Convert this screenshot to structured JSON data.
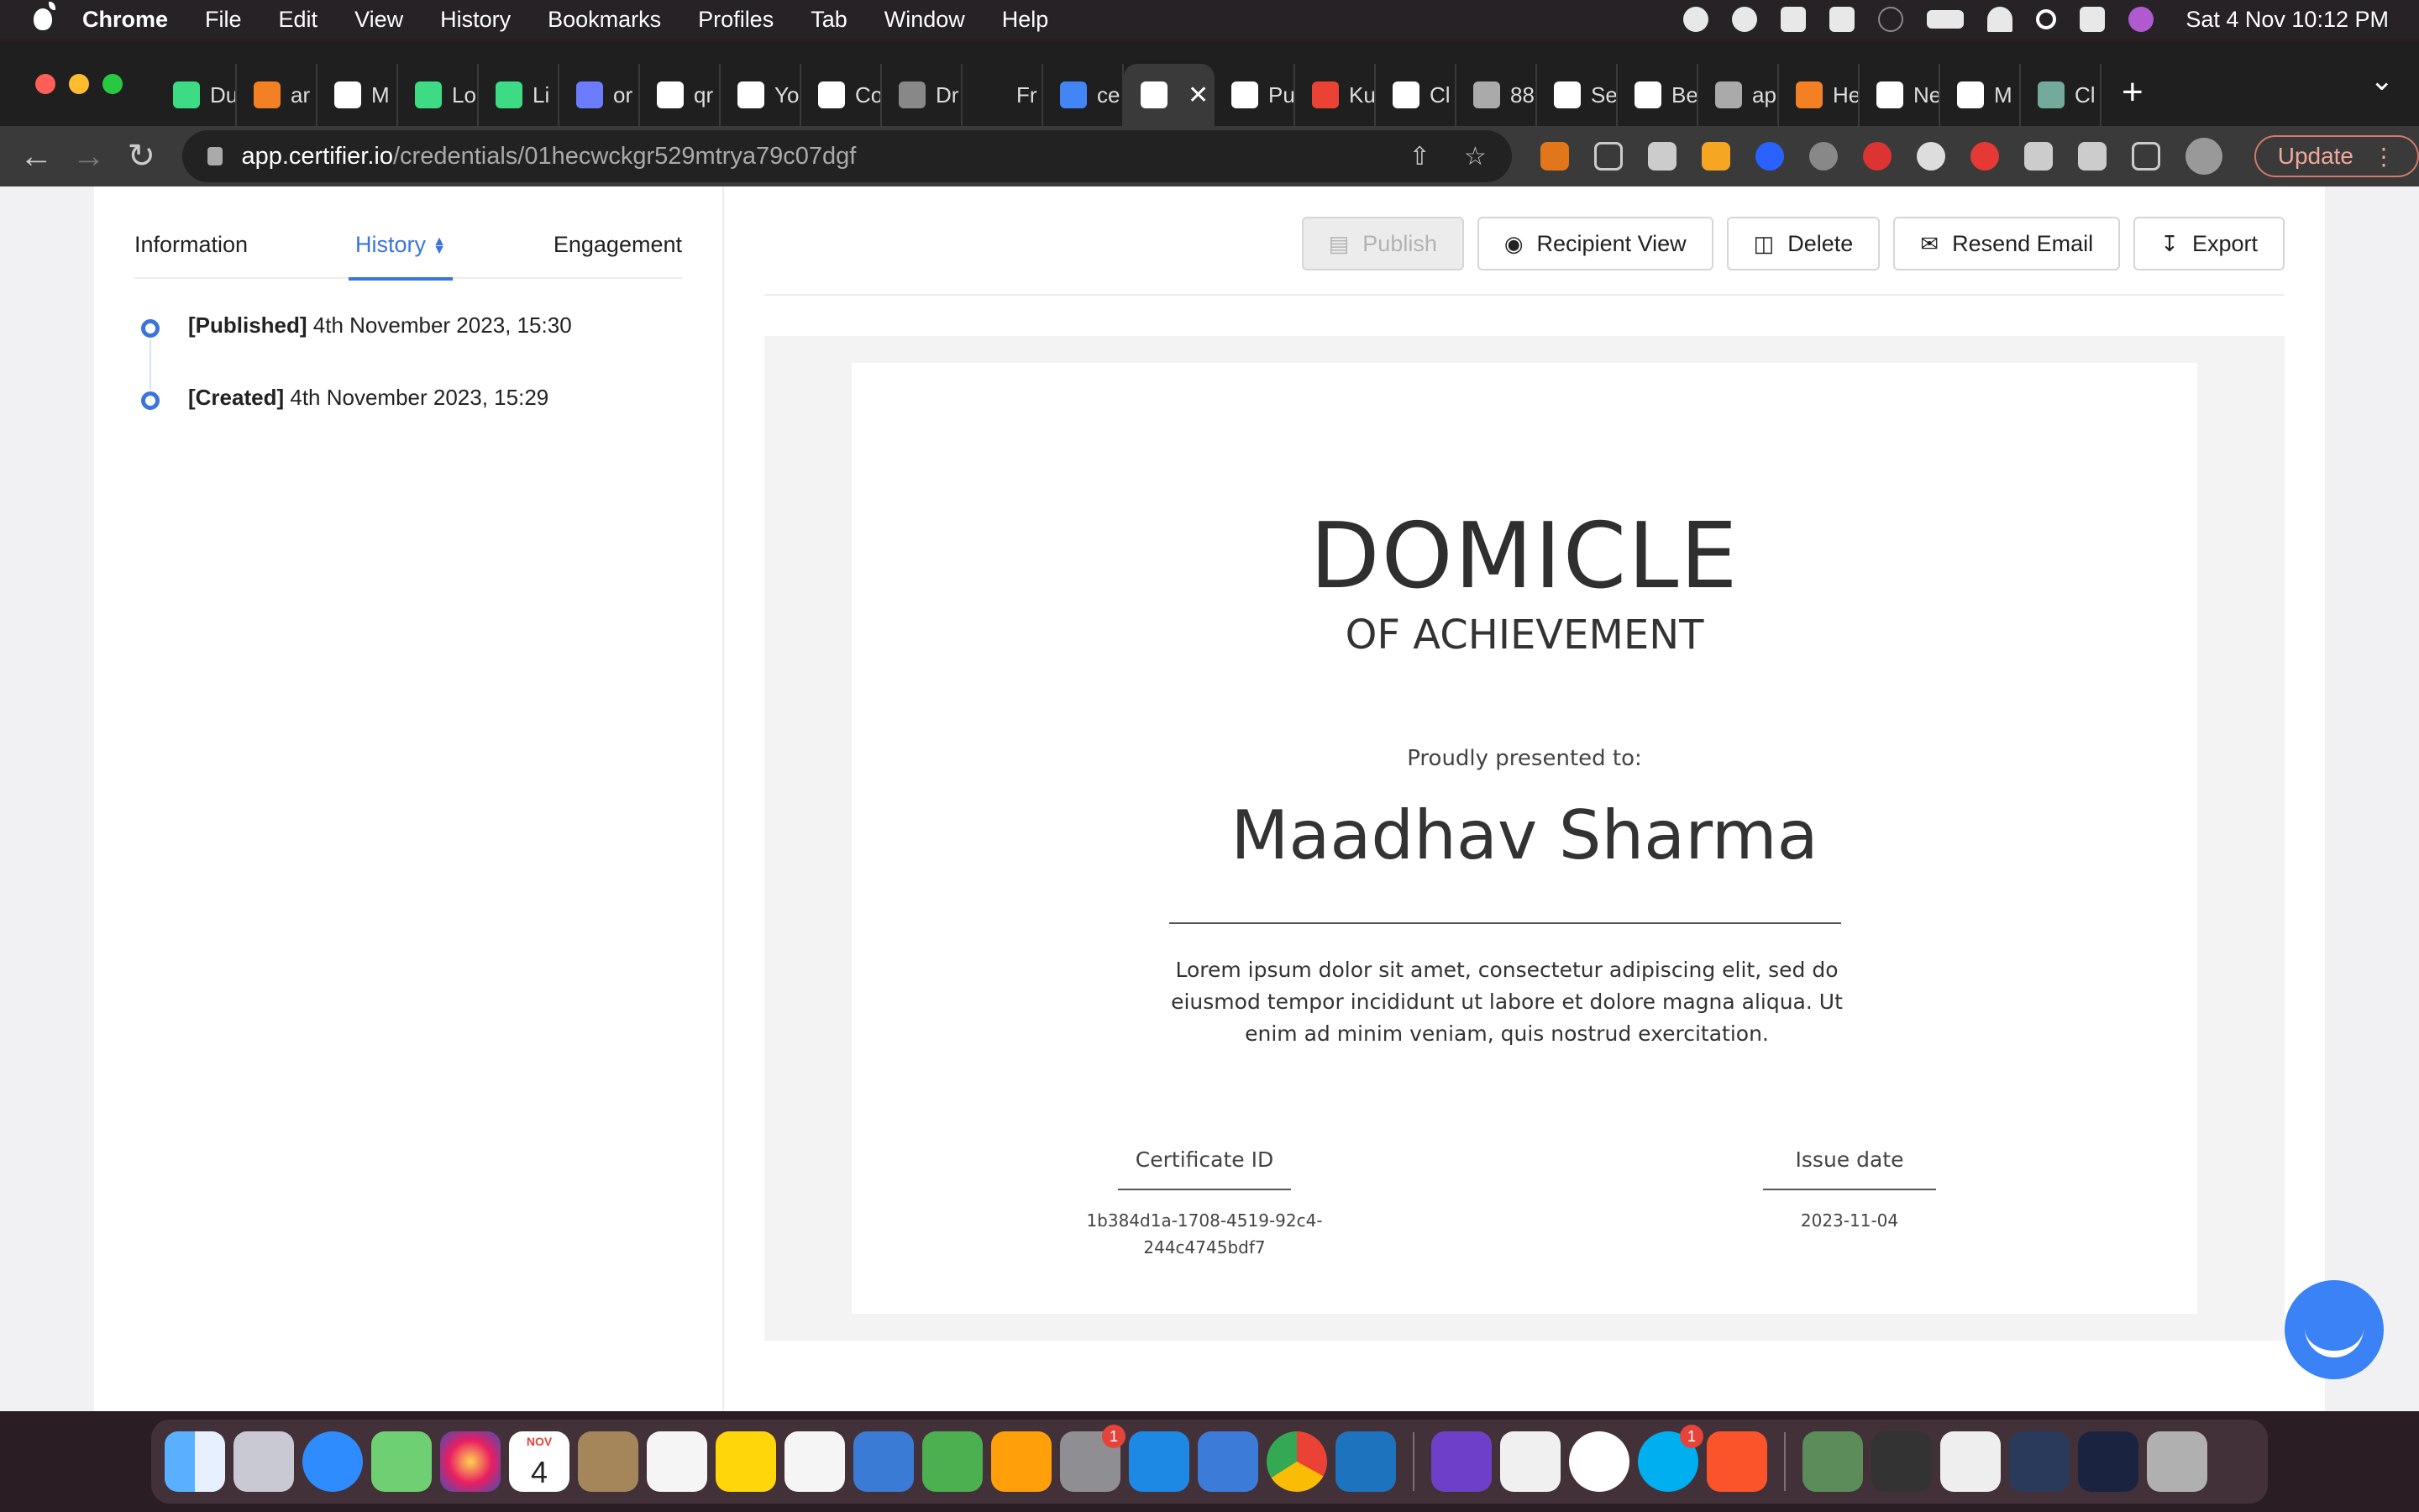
{
  "menubar": {
    "app_name": "Chrome",
    "items": [
      "File",
      "Edit",
      "View",
      "History",
      "Bookmarks",
      "Profiles",
      "Tab",
      "Window",
      "Help"
    ],
    "clock": "Sat 4 Nov  10:12 PM"
  },
  "browser": {
    "tabs": [
      {
        "label": "Du",
        "icon": "android-icon",
        "color": "#3ddc84"
      },
      {
        "label": "ar",
        "icon": "stackoverflow-icon",
        "color": "#f48024"
      },
      {
        "label": "M",
        "icon": "github-icon",
        "color": "#ffffff"
      },
      {
        "label": "Lo",
        "icon": "android-icon",
        "color": "#3ddc84"
      },
      {
        "label": "Li",
        "icon": "android-icon",
        "color": "#3ddc84"
      },
      {
        "label": "or",
        "icon": "globe-icon",
        "color": "#6b7cff"
      },
      {
        "label": "qr",
        "icon": "vercel-icon",
        "color": "#ffffff"
      },
      {
        "label": "Yo",
        "icon": "github-icon",
        "color": "#ffffff"
      },
      {
        "label": "Co",
        "icon": "vercel-icon",
        "color": "#ffffff"
      },
      {
        "label": "Dr",
        "icon": "ui-icon",
        "color": "#888888"
      },
      {
        "label": "Fr",
        "icon": "blank-icon",
        "color": "#1f1f1f"
      },
      {
        "label": "ce",
        "icon": "google-icon",
        "color": "#4285f4"
      },
      {
        "label": "",
        "icon": "certifier-icon",
        "color": "#ffffff",
        "active": true
      },
      {
        "label": "Pu",
        "icon": "certifier-icon",
        "color": "#ffffff"
      },
      {
        "label": "Ku",
        "icon": "gmail-icon",
        "color": "#ea4335"
      },
      {
        "label": "Cl",
        "icon": "certifier-icon",
        "color": "#ffffff"
      },
      {
        "label": "88",
        "icon": "globe-icon",
        "color": "#aaaaaa"
      },
      {
        "label": "Se",
        "icon": "gear-icon",
        "color": "#ffffff"
      },
      {
        "label": "Be",
        "icon": "cb-icon",
        "color": "#ffffff"
      },
      {
        "label": "ap",
        "icon": "globe-icon",
        "color": "#aaaaaa"
      },
      {
        "label": "He",
        "icon": "stackoverflow-icon",
        "color": "#f48024"
      },
      {
        "label": "Ne",
        "icon": "chrome-icon",
        "color": "#ffffff"
      },
      {
        "label": "M",
        "icon": "github-icon",
        "color": "#ffffff"
      },
      {
        "label": "Cl",
        "icon": "chatgpt-icon",
        "color": "#74aa9c"
      }
    ],
    "url_host": "app.certifier.io",
    "url_path": "/credentials/01hecwckgr529mtrya79c07dgf",
    "update_label": "Update"
  },
  "sidebar": {
    "tabs": [
      {
        "label": "Information",
        "active": false
      },
      {
        "label": "History",
        "active": true
      },
      {
        "label": "Engagement",
        "active": false
      }
    ],
    "history": [
      {
        "tag": "[Published]",
        "text": " 4th November 2023, 15:30"
      },
      {
        "tag": "[Created]",
        "text": " 4th November 2023, 15:29"
      }
    ]
  },
  "actions": {
    "publish": "Publish",
    "recipient_view": "Recipient View",
    "delete": "Delete",
    "resend_email": "Resend Email",
    "export": "Export"
  },
  "certificate": {
    "title": "DOMICLE",
    "subtitle": "OF ACHIEVEMENT",
    "presented_to": "Proudly presented to:",
    "recipient": "Maadhav Sharma",
    "body": "Lorem ipsum dolor sit amet, consectetur adipiscing elit, sed do eiusmod tempor incididunt ut labore et dolore magna aliqua. Ut enim ad minim veniam, quis nostrud exercitation.",
    "id_label": "Certificate ID",
    "id_value": "1b384d1a-1708-4519-92c4-244c4745bdf7",
    "date_label": "Issue date",
    "date_value": "2023-11-04"
  },
  "dock": {
    "calendar_month": "NOV",
    "calendar_day": "4",
    "badges": {
      "system_settings": "1",
      "skype": "1"
    }
  },
  "colors": {
    "accent": "#3b74dc",
    "page_bg": "#f1f1f3",
    "chat_bubble": "#3b82f6"
  }
}
